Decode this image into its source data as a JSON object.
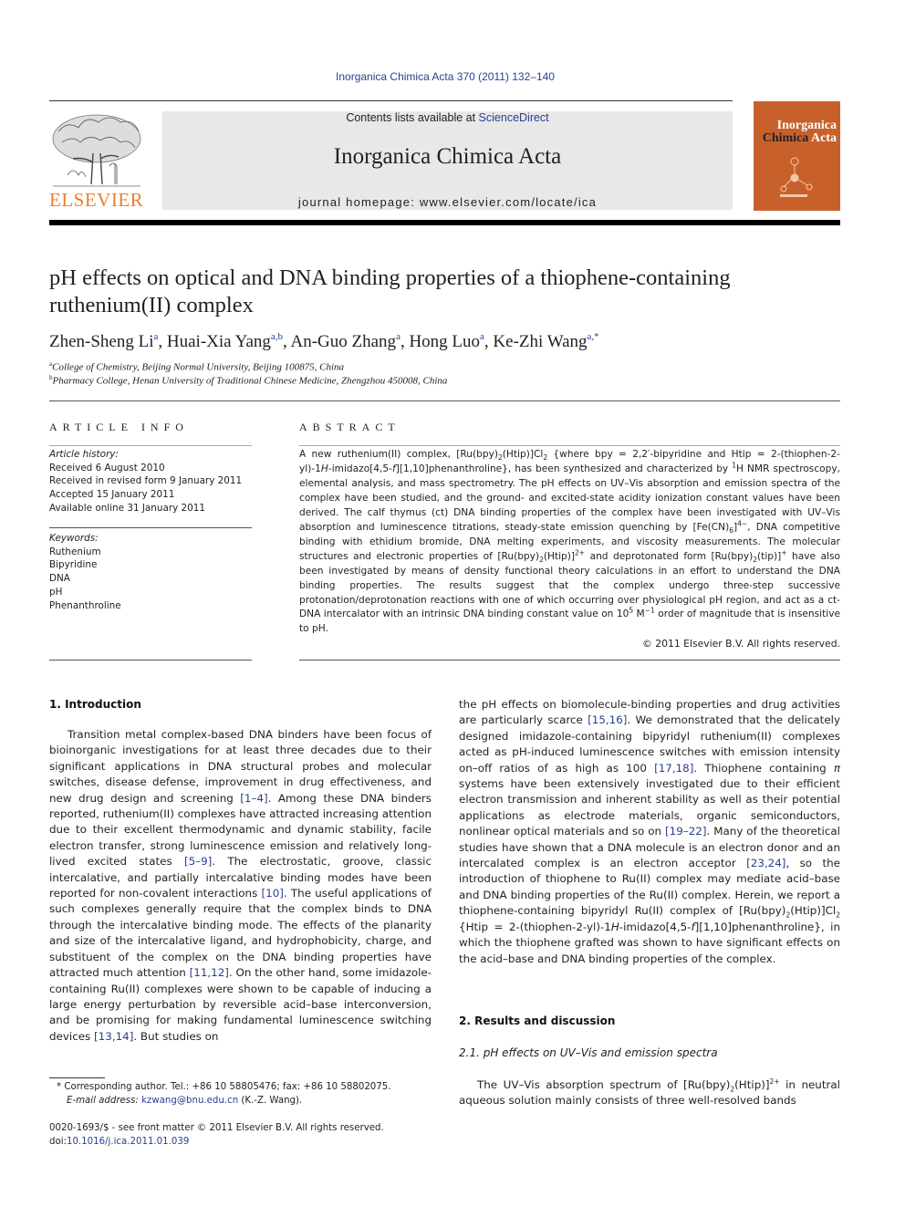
{
  "header": {
    "citation": "Inorganica Chimica Acta 370 (2011) 132–140",
    "contents_prefix": "Contents lists available at ",
    "contents_link": "ScienceDirect",
    "journal_title": "Inorganica Chimica Acta",
    "homepage": "journal homepage: www.elsevier.com/locate/ica",
    "publisher_logo": "ELSEVIER",
    "cover": {
      "line1": "Inorganica",
      "line2a": "Chimica",
      "line2b": " Acta"
    }
  },
  "article": {
    "title": "pH effects on optical and DNA binding properties of a thiophene-containing ruthenium(II) complex",
    "authors": [
      {
        "name": "Zhen-Sheng Li",
        "aff": "a"
      },
      {
        "name": "Huai-Xia Yang",
        "aff": "a,b"
      },
      {
        "name": "An-Guo Zhang",
        "aff": "a"
      },
      {
        "name": "Hong Luo",
        "aff": "a"
      },
      {
        "name": "Ke-Zhi Wang",
        "aff": "a,*"
      }
    ],
    "affiliations": [
      {
        "mark": "a",
        "text": "College of Chemistry, Beijing Normal University, Beijing 100875, China"
      },
      {
        "mark": "b",
        "text": "Pharmacy College, Henan University of Traditional Chinese Medicine, Zhengzhou 450008, China"
      }
    ]
  },
  "article_info": {
    "label": "ARTICLE INFO",
    "history_label": "Article history:",
    "history": [
      "Received 6 August 2010",
      "Received in revised form 9 January 2011",
      "Accepted 15 January 2011",
      "Available online 31 January 2011"
    ],
    "keywords_label": "Keywords:",
    "keywords": [
      "Ruthenium",
      "Bipyridine",
      "DNA",
      "pH",
      "Phenanthroline"
    ]
  },
  "abstract": {
    "label": "ABSTRACT",
    "copyright": "© 2011 Elsevier B.V. All rights reserved."
  },
  "sections": {
    "intro_heading": "1. Introduction",
    "results_heading": "2. Results and discussion",
    "subsection_heading": "2.1. pH effects on UV–Vis and emission spectra"
  },
  "footnotes": {
    "corresponding": "Corresponding author. Tel.: +86 10 58805476; fax: +86 10 58802075.",
    "email_label": "E-mail address:",
    "email": "kzwang@bnu.edu.cn",
    "email_suffix": " (K.-Z. Wang).",
    "issn": "0020-1693/$ - see front matter © 2011 Elsevier B.V. All rights reserved.",
    "doi_label": "doi:",
    "doi": "10.1016/j.ica.2011.01.039"
  },
  "colors": {
    "link": "#2a3f8f",
    "elsevier_orange": "#f07c2a",
    "cover": "#c8602c",
    "band": "#e8e8e8"
  }
}
